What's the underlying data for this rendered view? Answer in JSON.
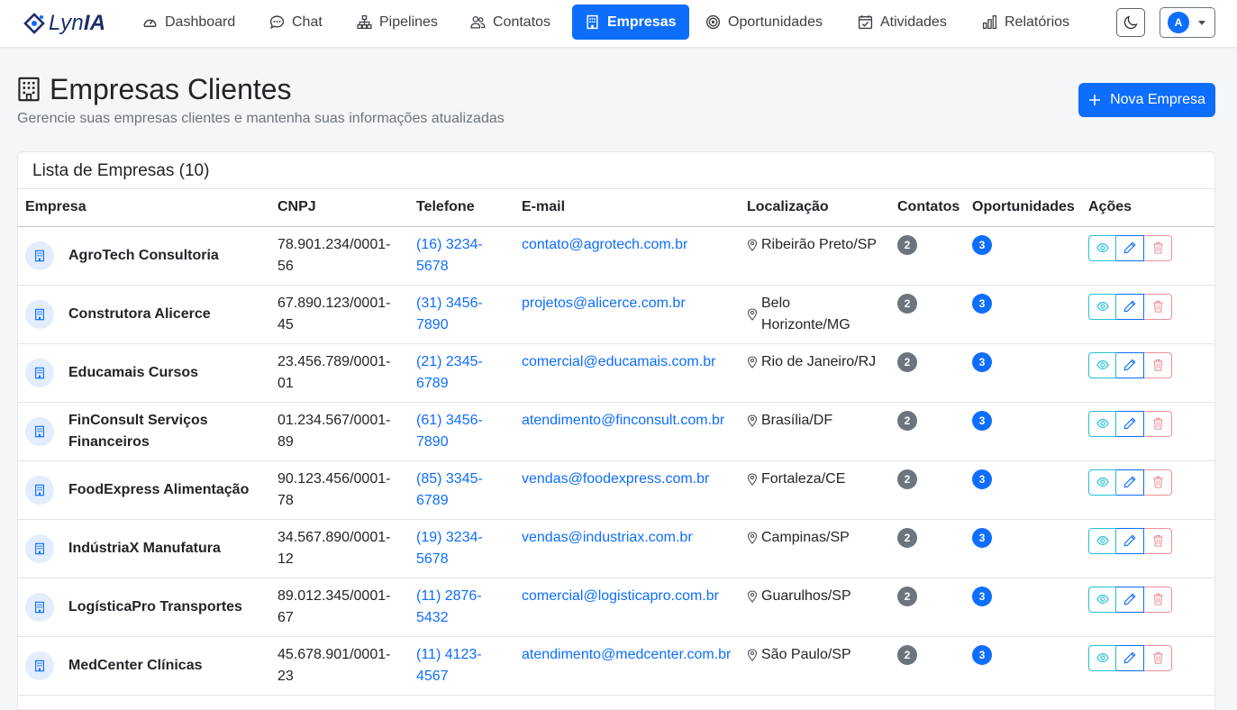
{
  "brand": {
    "prefix": "Lyn",
    "suffix": "IA"
  },
  "nav": {
    "dashboard": "Dashboard",
    "chat": "Chat",
    "pipelines": "Pipelines",
    "contatos": "Contatos",
    "empresas": "Empresas",
    "oportunidades": "Oportunidades",
    "atividades": "Atividades",
    "relatorios": "Relatórios"
  },
  "user": {
    "initial": "A"
  },
  "header": {
    "title": "Empresas Clientes",
    "subtitle": "Gerencie suas empresas clientes e mantenha suas informações atualizadas",
    "new_button": "Nova Empresa"
  },
  "list": {
    "title": "Lista de Empresas (10)",
    "columns": [
      "Empresa",
      "CNPJ",
      "Telefone",
      "E-mail",
      "Localização",
      "Contatos",
      "Oportunidades",
      "Ações"
    ],
    "rows": [
      {
        "name": "AgroTech Consultoria",
        "cnpj": "78.901.234/0001-56",
        "phone": "(16) 3234-5678",
        "email": "contato@agrotech.com.br",
        "location": "Ribeirão Preto/SP",
        "contacts": "2",
        "opportunities": "3"
      },
      {
        "name": "Construtora Alicerce",
        "cnpj": "67.890.123/0001-45",
        "phone": "(31) 3456-7890",
        "email": "projetos@alicerce.com.br",
        "location": "Belo Horizonte/MG",
        "contacts": "2",
        "opportunities": "3"
      },
      {
        "name": "Educamais Cursos",
        "cnpj": "23.456.789/0001-01",
        "phone": "(21) 2345-6789",
        "email": "comercial@educamais.com.br",
        "location": "Rio de Janeiro/RJ",
        "contacts": "2",
        "opportunities": "3"
      },
      {
        "name": "FinConsult Serviços Financeiros",
        "cnpj": "01.234.567/0001-89",
        "phone": "(61) 3456-7890",
        "email": "atendimento@finconsult.com.br",
        "location": "Brasília/DF",
        "contacts": "2",
        "opportunities": "3"
      },
      {
        "name": "FoodExpress Alimentação",
        "cnpj": "90.123.456/0001-78",
        "phone": "(85) 3345-6789",
        "email": "vendas@foodexpress.com.br",
        "location": "Fortaleza/CE",
        "contacts": "2",
        "opportunities": "3"
      },
      {
        "name": "IndústriaX Manufatura",
        "cnpj": "34.567.890/0001-12",
        "phone": "(19) 3234-5678",
        "email": "vendas@industriax.com.br",
        "location": "Campinas/SP",
        "contacts": "2",
        "opportunities": "3"
      },
      {
        "name": "LogísticaPro Transportes",
        "cnpj": "89.012.345/0001-67",
        "phone": "(11) 2876-5432",
        "email": "comercial@logisticapro.com.br",
        "location": "Guarulhos/SP",
        "contacts": "2",
        "opportunities": "3"
      },
      {
        "name": "MedCenter Clínicas",
        "cnpj": "45.678.901/0001-23",
        "phone": "(11) 4123-4567",
        "email": "atendimento@medcenter.com.br",
        "location": "São Paulo/SP",
        "contacts": "2",
        "opportunities": "3"
      }
    ]
  },
  "icons": {
    "nav": [
      "gauge-icon",
      "chat-icon",
      "diagram-icon",
      "people-icon",
      "building-icon",
      "target-icon",
      "calendar-check-icon",
      "bar-chart-icon"
    ],
    "row": [
      "building-icon",
      "geo-pin-icon",
      "eye-icon",
      "pencil-icon",
      "trash-icon"
    ]
  },
  "colors": {
    "primary": "#0d6efd",
    "info": "#20c0d8",
    "danger": "#dc3545",
    "secondary": "#6c757d",
    "brand": "#1d2e6e"
  }
}
